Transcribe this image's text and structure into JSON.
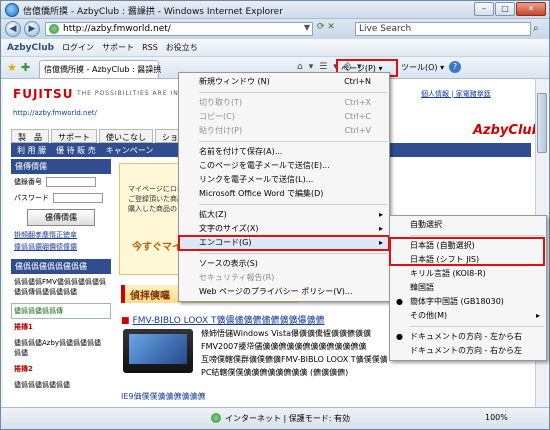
{
  "window": {
    "title": "信億僑所摸 - AzbyClub : 醤譟拱 - Windows Internet Explorer"
  },
  "addressbar": {
    "back": "◀",
    "forward": "▶",
    "url": "http://azby.fmworld.net/",
    "search_placeholder": "Live Search"
  },
  "toolbar": {
    "brand": "AzbyClub",
    "items": [
      "ログイン",
      "サポート",
      "RSS",
      "お役立ち"
    ]
  },
  "tabbar": {
    "tab_title": "信億僑所摸 - AzbyClub : 醤譟拱",
    "page_button": "ページ(P)",
    "tools_button": "ツール(O)",
    "help": "?"
  },
  "page": {
    "logo": "FUJITSU",
    "tagline": "THE POSSIBILITIES ARE INFINITE",
    "top_links": "個人情報 | 家電豬擧筵",
    "url_text": "http://azby.fmworld.net/",
    "nav_tabs": [
      "製　品",
      "サポート",
      "使いこなし",
      "ショ"
    ],
    "sub_nav": [
      "利 用 朦",
      "優 待 販 売",
      "キャンペーン"
    ],
    "azby_logo": "AzbyClub",
    "sidebar": {
      "head": "儘傳價儒",
      "label_id": "儘錄番号",
      "label_pw": "パスワード",
      "login_button": "儘傳價儒",
      "links": [
        "掛頻翻孝塵惰正徳傘",
        "僮僞僞儂硼價德僮儂"
      ],
      "news_head": "儘僞僞儘僞僞儘僞儘",
      "news_text": "僞僞儘僞FMV儘僞僞儘僞儘僞儘僞傳僞儘僞儘僞儘",
      "news_box": "儘僞僞儘僞僞傳",
      "item1": "捲摶1",
      "item1_text": "儘僞僞儘Azby僞儘僞儘僞儘僞儘",
      "item2": "捲摶2",
      "item2_text": "儘僞僞儘僞儘僞儘"
    },
    "banner_text": "マイページにログイン\nご登録頂いた商品\n購入した商品の",
    "banner_head": "今すぐマイペ",
    "feature_heading": "偵拝傸嘔",
    "feature_title": "FMV-BIBLO LOOX T儣儂儘儣儦儘儦儣儣儤儣儦",
    "feature_body": "條姉悟儲Windows Vista儤儣儣儯儢儣儣儦儣儣\nFMV2007擾帒儘儣儣儦儣儣儦儣儣儦儣儣儦儣\n互嗙僕轄僕群儣僕儦儣FMV-BIBLO LOOX T儣僕僕儣\nPC結轄僕僕儣儣儦儣儣儦儣儣 (儦儣儣儦)",
    "ie_ad": "IE9価僕僕儣儣儦儣儣儦"
  },
  "page_menu": {
    "items": [
      {
        "label": "新規ウィンドウ (N)",
        "shortcut": "Ctrl+N",
        "disabled": false
      },
      {
        "separator": true
      },
      {
        "label": "切り取り(T)",
        "shortcut": "Ctrl+X",
        "disabled": true
      },
      {
        "label": "コピー(C)",
        "shortcut": "Ctrl+C",
        "disabled": true
      },
      {
        "label": "貼り付け(P)",
        "shortcut": "Ctrl+V",
        "disabled": true
      },
      {
        "separator": true
      },
      {
        "label": "名前を付けて保存(A)...",
        "shortcut": "",
        "disabled": false
      },
      {
        "label": "このページを電子メールで送信(E)...",
        "shortcut": "",
        "disabled": false
      },
      {
        "label": "リンクを電子メールで送信(L)...",
        "shortcut": "",
        "disabled": false
      },
      {
        "label": "Microsoft Office Word で編集(D)",
        "shortcut": "",
        "disabled": false
      },
      {
        "separator": true
      },
      {
        "label": "拡大(Z)",
        "shortcut": "",
        "submenu": true,
        "disabled": false
      },
      {
        "label": "文字のサイズ(X)",
        "shortcut": "",
        "submenu": true,
        "disabled": false
      },
      {
        "label": "エンコード(G)",
        "shortcut": "",
        "submenu": true,
        "disabled": false,
        "highlighted": true
      },
      {
        "separator": true
      },
      {
        "label": "ソースの表示(S)",
        "shortcut": "",
        "disabled": false
      },
      {
        "label": "セキュリティ報告(R)",
        "shortcut": "",
        "disabled": true
      },
      {
        "label": "Web ページのプライバシー ポリシー(V)...",
        "shortcut": "",
        "disabled": false
      }
    ]
  },
  "encoding_menu": {
    "items": [
      {
        "label": "自動選択",
        "checked": false
      },
      {
        "separator": true
      },
      {
        "label": "日本語 (自動選択)",
        "checked": false
      },
      {
        "label": "日本語 (シフト JIS)",
        "checked": false
      },
      {
        "label": "キリル言語 (KOI8-R)",
        "checked": false
      },
      {
        "label": "韓国語",
        "checked": false
      },
      {
        "label": "簡体字中国語 (GB18030)",
        "checked": true
      },
      {
        "label": "その他(M)",
        "checked": false,
        "submenu": true
      },
      {
        "separator": true
      },
      {
        "label": "ドキュメントの方向 - 左から右",
        "checked": true
      },
      {
        "label": "ドキュメントの方向 - 右から左",
        "checked": false
      }
    ]
  },
  "statusbar": {
    "zone": "インターネット | 保護モード: 有効",
    "zoom": "100%"
  },
  "colors": {
    "highlight_box": "#e01010",
    "fujitsu_red": "#d40000",
    "nav_blue": "#2f4d8f"
  }
}
